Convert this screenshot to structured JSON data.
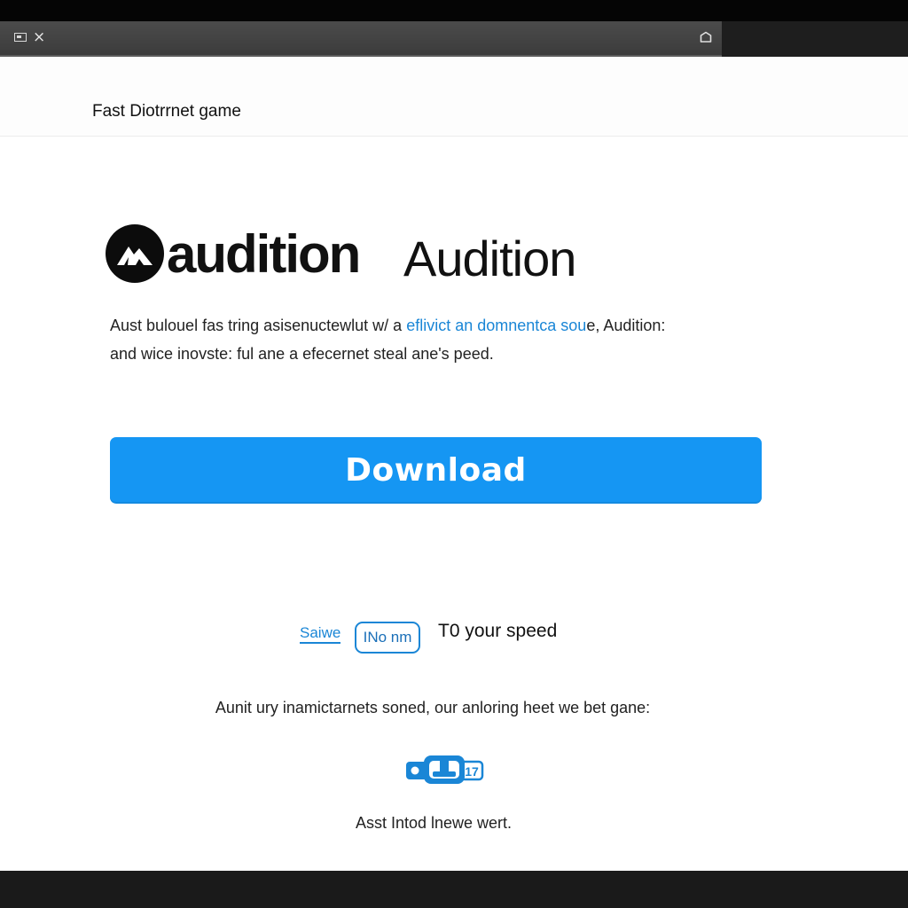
{
  "window": {
    "close_glyph": "×",
    "icons": [
      "window-icon",
      "home-icon"
    ]
  },
  "header": {
    "title": "Fast Diotrrnet game"
  },
  "brand": {
    "wordmark": "audition",
    "name": "Audition",
    "logo_icon": "mountain-logo-icon"
  },
  "description": {
    "line1_start": "Aust bulouel fas tring asisenuctewlut w/ a ",
    "line1_link": "eflivict an domnentca sou",
    "line1_end": "e, Audition:",
    "line2": "and wice inovste: ful ane a efecernet steal ane's peed."
  },
  "download": {
    "label": "Download"
  },
  "speed": {
    "save_link": "Saiwe",
    "input_value": "INo nm",
    "label": "T0 your speed"
  },
  "info": {
    "text": "Aunit ury inamictarnets soned, our anloring heet we bet gane:",
    "icon": "timer-icon"
  },
  "footer": {
    "text": "Asst Intod lnewe wert."
  },
  "colors": {
    "accent": "#1596f3",
    "link": "#1a86d6",
    "text": "#111111",
    "titlebar": "#404040"
  }
}
